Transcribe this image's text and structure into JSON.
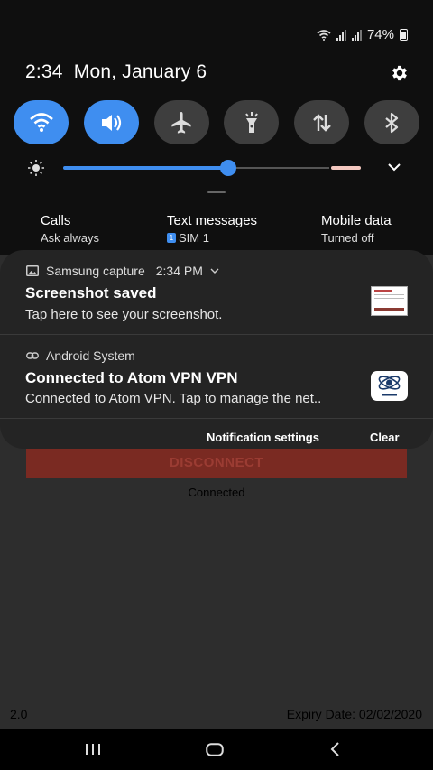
{
  "status_bar": {
    "battery": "74%"
  },
  "header": {
    "time": "2:34",
    "date": "Mon, January 6"
  },
  "quick_settings": [
    {
      "name": "wifi-icon",
      "on": true
    },
    {
      "name": "sound-icon",
      "on": true
    },
    {
      "name": "airplane-icon",
      "on": false
    },
    {
      "name": "flashlight-icon",
      "on": false
    },
    {
      "name": "mobile-data-icon",
      "on": false
    },
    {
      "name": "bluetooth-icon",
      "on": false
    }
  ],
  "brightness": {
    "level": 0.56
  },
  "sim_info": {
    "calls": {
      "title": "Calls",
      "sub": "Ask always"
    },
    "texts": {
      "title": "Text messages",
      "sim_badge": "1",
      "sub": "SIM 1"
    },
    "data": {
      "title": "Mobile data",
      "sub": "Turned off"
    }
  },
  "notifications": [
    {
      "app": "Samsung capture",
      "time": "2:34 PM",
      "title": "Screenshot saved",
      "text": "Tap here to see your screenshot."
    },
    {
      "app": "Android System",
      "title": "Connected to Atom VPN VPN",
      "text": "Connected to Atom VPN. Tap to manage the net.."
    }
  ],
  "notif_footer": {
    "settings": "Notification settings",
    "clear": "Clear"
  },
  "app": {
    "button": "DISCONNECT",
    "status": "Connected",
    "version": "2.0",
    "expiry": "Expiry Date: 02/02/2020"
  },
  "colors": {
    "accent": "#3f8ef0",
    "panel": "#242424",
    "shade": "#0f0f0f"
  }
}
